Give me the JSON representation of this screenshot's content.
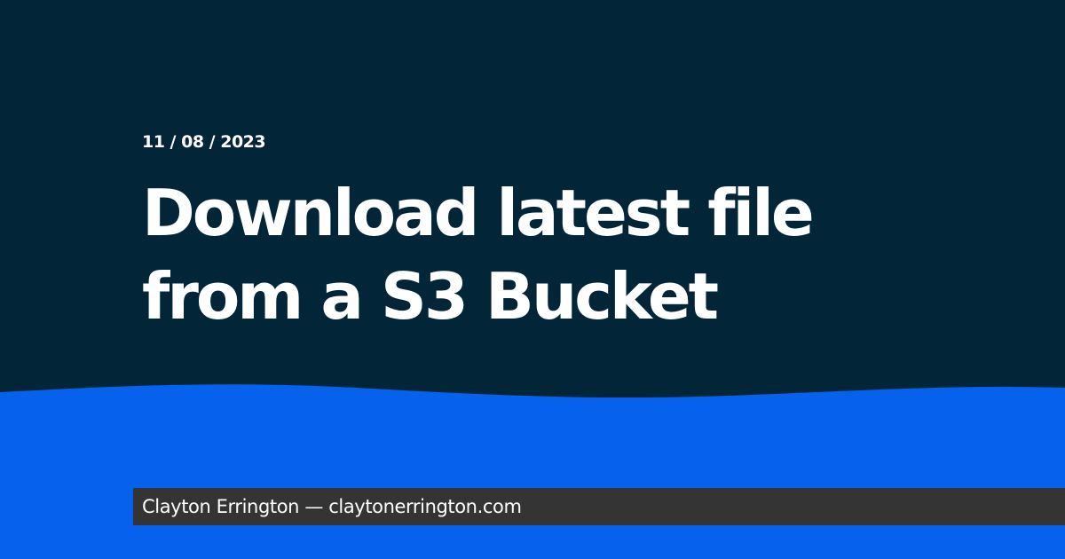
{
  "post": {
    "date": "11 / 08 / 2023",
    "title": "Download latest file from a S3 Bucket"
  },
  "footer": {
    "text": "Clayton Errington — claytonerrington.com"
  },
  "colors": {
    "background": "#032538",
    "wave": "#0661ed",
    "footer_bar": "#343434",
    "text": "#ffffff"
  }
}
